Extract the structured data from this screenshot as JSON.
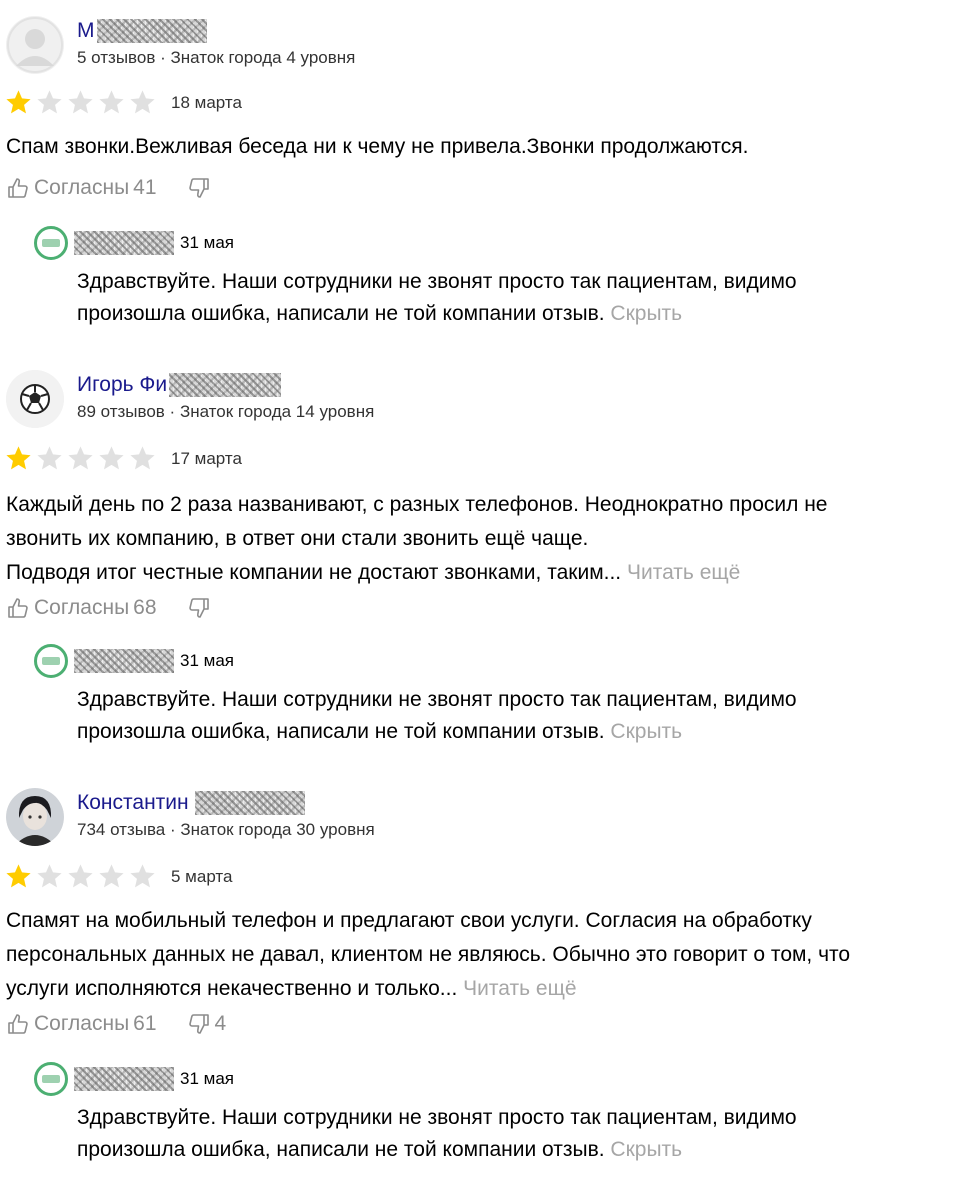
{
  "colors": {
    "author_link": "#1a1a8c",
    "star_filled": "#ffcc00",
    "star_empty": "#e0e0e0",
    "muted_link": "#a6a6a6",
    "reaction_grey": "#8c8c8c",
    "org_logo_ring": "#4caf72"
  },
  "reviews": [
    {
      "avatar_icon": "default-user-avatar-icon",
      "author_name": "М",
      "author_meta": "5 отзывов · Знаток города 4 уровня",
      "rating": 1,
      "rating_max": 5,
      "date": "18 марта",
      "text_lines": [
        "Спам звонки.Вежливая беседа ни к чему не привела.Звонки продолжаются."
      ],
      "read_more": "",
      "agree_label": "Согласны",
      "agree_count": "41",
      "dislike_count": "",
      "reply": {
        "logo_icon": "organization-logo-icon",
        "date": "31 мая",
        "text_lines": [
          "Здравствуйте. Наши сотрудники не звонят просто так пациентам, видимо",
          "произошла ошибка, написали не той компании отзыв."
        ],
        "hide_label": "Скрыть"
      }
    },
    {
      "avatar_icon": "soccer-ball-avatar-icon",
      "author_name": "Игорь Фи",
      "author_meta": "89 отзывов · Знаток города 14 уровня",
      "rating": 1,
      "rating_max": 5,
      "date": "17 марта",
      "text_lines": [
        "Каждый день по 2 раза названивают, с разных телефонов. Неоднократно просил не",
        "звонить их компанию, в ответ они стали звонить ещё чаще.",
        "Подводя итог честные компании не достают звонками, таким..."
      ],
      "read_more": "Читать ещё",
      "agree_label": "Согласны",
      "agree_count": "68",
      "dislike_count": "",
      "reply": {
        "logo_icon": "organization-logo-icon",
        "date": "31 мая",
        "text_lines": [
          "Здравствуйте. Наши сотрудники не звонят просто так пациентам, видимо",
          "произошла ошибка, написали не той компании отзыв."
        ],
        "hide_label": "Скрыть"
      }
    },
    {
      "avatar_icon": "anime-character-avatar-icon",
      "author_name": "Константин",
      "author_meta": "734 отзыва · Знаток города 30 уровня",
      "rating": 1,
      "rating_max": 5,
      "date": "5 марта",
      "text_lines": [
        "Спамят на мобильный телефон и предлагают свои услуги. Согласия на обработку",
        "персональных данных не давал, клиентом не являюсь. Обычно это говорит о том, что",
        "услуги исполняются некачественно и только..."
      ],
      "read_more": "Читать ещё",
      "agree_label": "Согласны",
      "agree_count": "61",
      "dislike_count": "4",
      "reply": {
        "logo_icon": "organization-logo-icon",
        "date": "31 мая",
        "text_lines": [
          "Здравствуйте. Наши сотрудники не звонят просто так пациентам, видимо",
          "произошла ошибка, написали не той компании отзыв."
        ],
        "hide_label": "Скрыть"
      }
    }
  ]
}
